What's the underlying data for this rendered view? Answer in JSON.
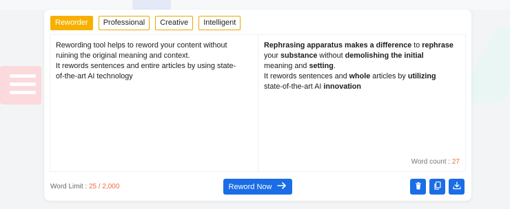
{
  "tabs": [
    {
      "label": "Reworder",
      "active": true
    },
    {
      "label": "Professional",
      "active": false
    },
    {
      "label": "Creative",
      "active": false
    },
    {
      "label": "Intelligent",
      "active": false
    }
  ],
  "input": {
    "lines": [
      "Rewording tool helps to reword your content without",
      "ruining the original meaning and context.",
      "It rewords sentences and entire articles by using state-",
      "of-the-art AI technology"
    ]
  },
  "output": {
    "lines": [
      [
        {
          "t": "Rephrasing apparatus makes a difference",
          "b": true
        },
        {
          "t": " to ",
          "b": false
        },
        {
          "t": "rephrase",
          "b": true
        }
      ],
      [
        {
          "t": "your ",
          "b": false
        },
        {
          "t": "substance",
          "b": true
        },
        {
          "t": " without ",
          "b": false
        },
        {
          "t": "demolishing the initial",
          "b": true
        }
      ],
      [
        {
          "t": "meaning and ",
          "b": false
        },
        {
          "t": "setting",
          "b": true
        },
        {
          "t": ".",
          "b": false
        }
      ],
      [
        {
          "t": "It rewords sentences and ",
          "b": false
        },
        {
          "t": "whole",
          "b": true
        },
        {
          "t": " articles by ",
          "b": false
        },
        {
          "t": "utilizing",
          "b": true
        }
      ],
      [
        {
          "t": "state-of-the-art AI ",
          "b": false
        },
        {
          "t": "innovation",
          "b": true
        }
      ]
    ],
    "word_count_label": "Word count : ",
    "word_count_value": "27"
  },
  "footer": {
    "limit_label": "Word Limit : ",
    "limit_value": "25 / 2,000",
    "reword_label": "Reword Now"
  },
  "icons": {
    "arrow": "arrow-right-icon",
    "delete": "trash-icon",
    "copy": "copy-icon",
    "download": "download-icon"
  },
  "colors": {
    "accent": "#1a6de6",
    "tab_active": "#f7b000",
    "count": "#f26b3a"
  }
}
